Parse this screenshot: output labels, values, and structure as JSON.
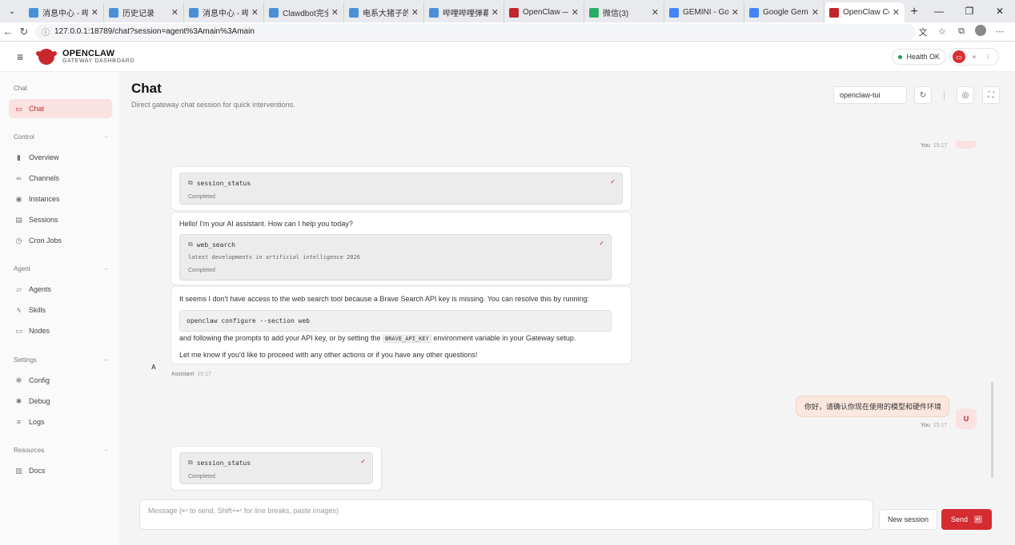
{
  "browser": {
    "tabs": [
      {
        "title": "消息中心 - 哔哩哔",
        "color": "#4a90d9"
      },
      {
        "title": "历史记录",
        "color": "#4a90d9"
      },
      {
        "title": "消息中心 - 哔哩哔",
        "color": "#4a90d9"
      },
      {
        "title": "Clawdbot完全本地",
        "color": "#4a90d9"
      },
      {
        "title": "电系大猪子的个人",
        "color": "#4a90d9"
      },
      {
        "title": "哔哩哔哩弹幕视频",
        "color": "#4a90d9"
      },
      {
        "title": "OpenClaw — Per",
        "color": "#c0262b"
      },
      {
        "title": "微信(3)",
        "color": "#2aae67"
      },
      {
        "title": "GEMINI - Google",
        "color": "#4285f4"
      },
      {
        "title": "Google Gemini",
        "color": "#4285f4"
      },
      {
        "title": "OpenClaw Contro",
        "color": "#c0262b"
      }
    ],
    "url": "127.0.0.1:18789/chat?session=agent%3Amain%3Amain"
  },
  "header": {
    "brand_title": "OPENCLAW",
    "brand_subtitle": "GATEWAY DASHBOARD",
    "health": "Health OK",
    "accent_color": "#d42c30"
  },
  "sidebar": {
    "sections": [
      {
        "label": "Chat",
        "items": [
          {
            "label": "Chat",
            "icon": "chat-bubble-icon",
            "active": true
          }
        ]
      },
      {
        "label": "Control",
        "items": [
          {
            "label": "Overview",
            "icon": "bar-chart-icon"
          },
          {
            "label": "Channels",
            "icon": "link-icon"
          },
          {
            "label": "Instances",
            "icon": "broadcast-icon"
          },
          {
            "label": "Sessions",
            "icon": "document-icon"
          },
          {
            "label": "Cron Jobs",
            "icon": "timer-icon"
          }
        ]
      },
      {
        "label": "Agent",
        "items": [
          {
            "label": "Agents",
            "icon": "folder-icon"
          },
          {
            "label": "Skills",
            "icon": "lightning-icon"
          },
          {
            "label": "Nodes",
            "icon": "monitor-icon"
          }
        ]
      },
      {
        "label": "Settings",
        "items": [
          {
            "label": "Config",
            "icon": "gear-icon"
          },
          {
            "label": "Debug",
            "icon": "bug-icon"
          },
          {
            "label": "Logs",
            "icon": "log-icon"
          }
        ]
      },
      {
        "label": "Resources",
        "items": [
          {
            "label": "Docs",
            "icon": "book-icon"
          }
        ]
      }
    ]
  },
  "main": {
    "title": "Chat",
    "subtitle": "Direct gateway chat session for quick interventions.",
    "session_select": "openclaw-tui",
    "messages": {
      "top_meta": {
        "who": "You",
        "time": "15:17"
      },
      "tool1": {
        "name": "session_status",
        "status": "Completed"
      },
      "greeting": "Hello! I'm your AI assistant. How can I help you today?",
      "tool2": {
        "name": "web_search",
        "arg": "latest developments in artificial intelligence 2026",
        "status": "Completed"
      },
      "resp_line1": "It seems I don't have access to the web search tool because a Brave Search API key is missing. You can resolve this by running:",
      "code": "openclaw configure --section web",
      "resp_line2_a": "and following the prompts to add your API key, or by setting the",
      "resp_inline_code": "BRAVE_API_KEY",
      "resp_line2_b": "environment variable in your Gateway setup.",
      "resp_line3": "Let me know if you'd like to proceed with any other actions or if you have any other questions!",
      "assistant_avatar": "A",
      "assistant_meta": {
        "who": "Assistant",
        "time": "15:17"
      },
      "user_msg": "你好，请确认你现在使用的模型和硬件环境",
      "user_avatar": "U",
      "user_meta": {
        "who": "You",
        "time": "15:17"
      },
      "tool3": {
        "name": "session_status",
        "status": "Completed"
      }
    },
    "composer_placeholder": "Message (↩ to send, Shift+↩ for line breaks, paste images)",
    "new_session": "New session",
    "send": "Send"
  }
}
